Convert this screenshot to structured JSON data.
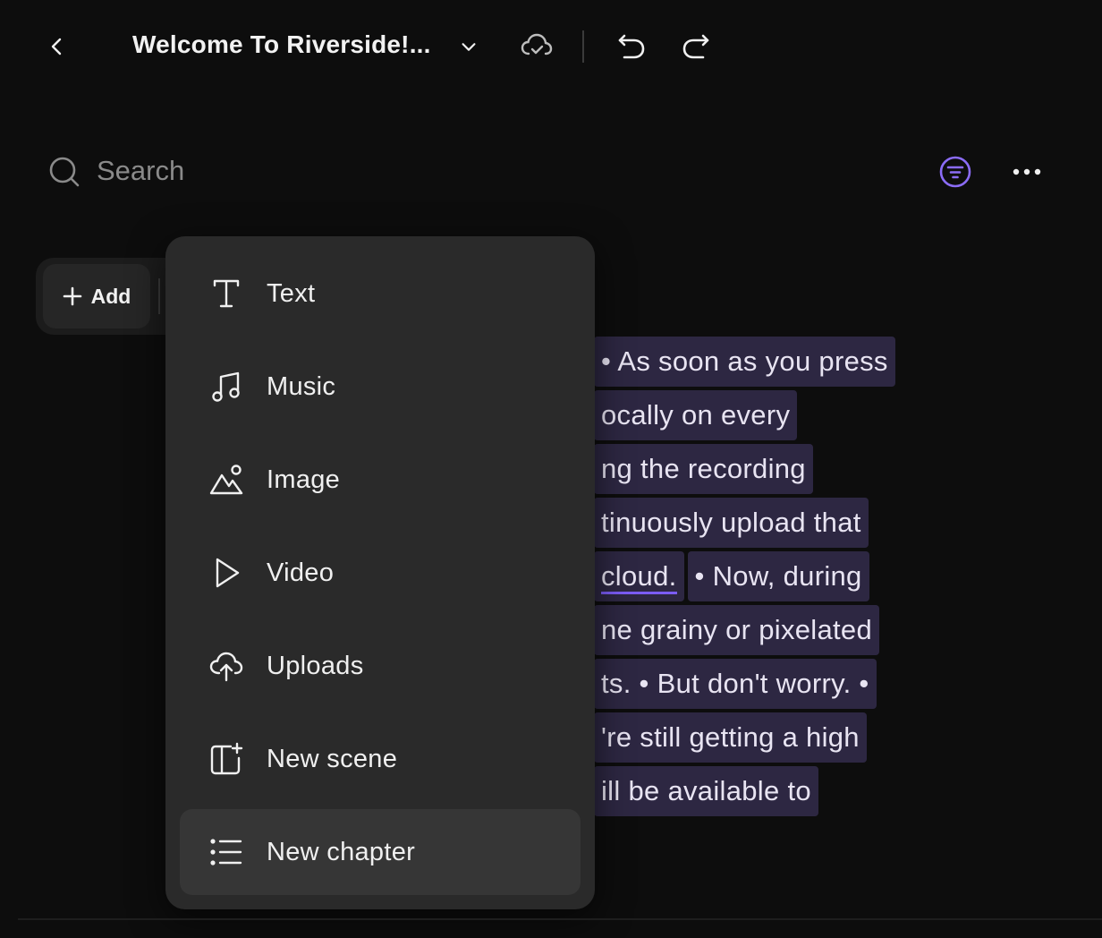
{
  "header": {
    "title": "Welcome To Riverside!...",
    "icons": [
      "chevron-left-icon",
      "chevron-down-icon",
      "cloud-check-icon",
      "undo-icon",
      "redo-icon"
    ]
  },
  "search": {
    "placeholder": "Search",
    "value": ""
  },
  "toolbar": {
    "add_label": "Add"
  },
  "menu": {
    "items": [
      {
        "label": "Text",
        "icon": "text-icon"
      },
      {
        "label": "Music",
        "icon": "music-note-icon"
      },
      {
        "label": "Image",
        "icon": "image-icon"
      },
      {
        "label": "Video",
        "icon": "play-icon"
      },
      {
        "label": "Uploads",
        "icon": "cloud-upload-icon"
      },
      {
        "label": "New scene",
        "icon": "new-scene-icon"
      },
      {
        "label": "New chapter",
        "icon": "list-icon"
      }
    ],
    "active_index": 6
  },
  "transcript": {
    "lines": [
      [
        "• As soon as you press"
      ],
      [
        "ocally on every"
      ],
      [
        "ng the recording"
      ],
      [
        "tinuously upload that"
      ],
      [
        "cloud.",
        "• Now, during"
      ],
      [
        "ne grainy or pixelated"
      ],
      [
        "ts. • But don't worry. •"
      ],
      [
        "'re still getting a high"
      ],
      [
        "ill be available to"
      ]
    ]
  },
  "colors": {
    "background": "#0d0d0d",
    "menu_bg": "#2a2a2a",
    "highlight": "#2d2742",
    "accent": "#7b5cf5"
  }
}
